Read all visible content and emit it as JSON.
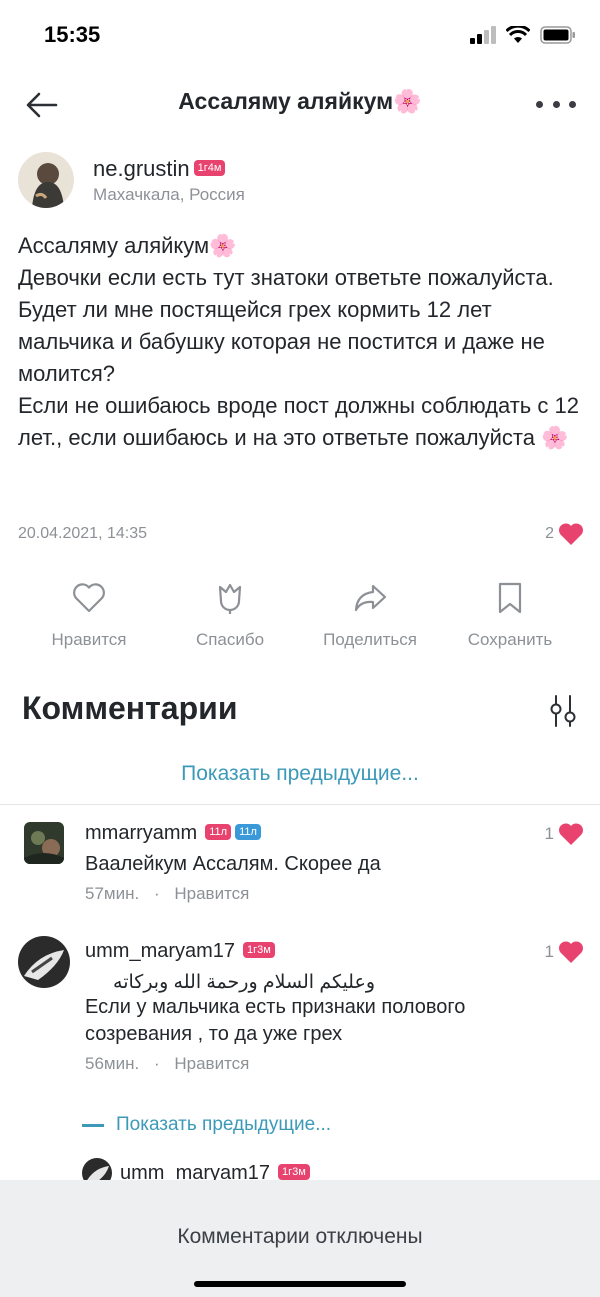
{
  "status_bar": {
    "time": "15:35"
  },
  "nav": {
    "title": "Ассаляму аляйкум🌸",
    "back_icon": "arrow-left-icon",
    "more_icon": "more-dots-icon"
  },
  "post": {
    "author": {
      "name": "ne.grustin",
      "badge": "1г4м",
      "location": "Махачкала, Россия"
    },
    "body": "Ассаляму аляйкум🌸\nДевочки если есть тут знатоки ответьте пожалуйста.\nБудет ли мне постящейся  грех кормить 12 лет мальчика и бабушку которая не постится и даже не молится?\nЕсли не ошибаюсь вроде пост должны соблюдать с 12 лет., если ошибаюсь и на это ответьте пожалуйста 🌸",
    "date": "20.04.2021, 14:35",
    "likes": "2"
  },
  "actions": [
    {
      "label": "Нравится",
      "icon": "heart-outline-icon"
    },
    {
      "label": "Спасибо",
      "icon": "tulip-icon"
    },
    {
      "label": "Поделиться",
      "icon": "share-arrow-icon"
    },
    {
      "label": "Сохранить",
      "icon": "bookmark-icon"
    }
  ],
  "comments_section": {
    "title": "Комментарии",
    "show_previous": "Показать предыдущие...",
    "items": [
      {
        "name": "mmarryamm",
        "badges": [
          "11л",
          "11л"
        ],
        "text": "Ваалейкум Ассалям. Скорее да",
        "time": "57мин.",
        "like_action": "Нравится",
        "likes": "1"
      },
      {
        "name": "umm_maryam17",
        "badges": [
          "1г3м"
        ],
        "text_arabic": "وعليكم السلام ورحمة الله وبركاته",
        "text": "Если у мальчика есть признаки полового созревания , то да уже грех",
        "time": "56мин.",
        "like_action": "Нравится",
        "likes": "1"
      }
    ],
    "reply_toggle": "Показать предыдущие...",
    "partial_reply": {
      "name": "umm_maryam17",
      "badge": "1г3м"
    }
  },
  "footer": {
    "text": "Комментарии отключены"
  },
  "colors": {
    "accent_pink": "#e8436f",
    "link_blue": "#3c9ab8",
    "muted": "#8d9196"
  }
}
